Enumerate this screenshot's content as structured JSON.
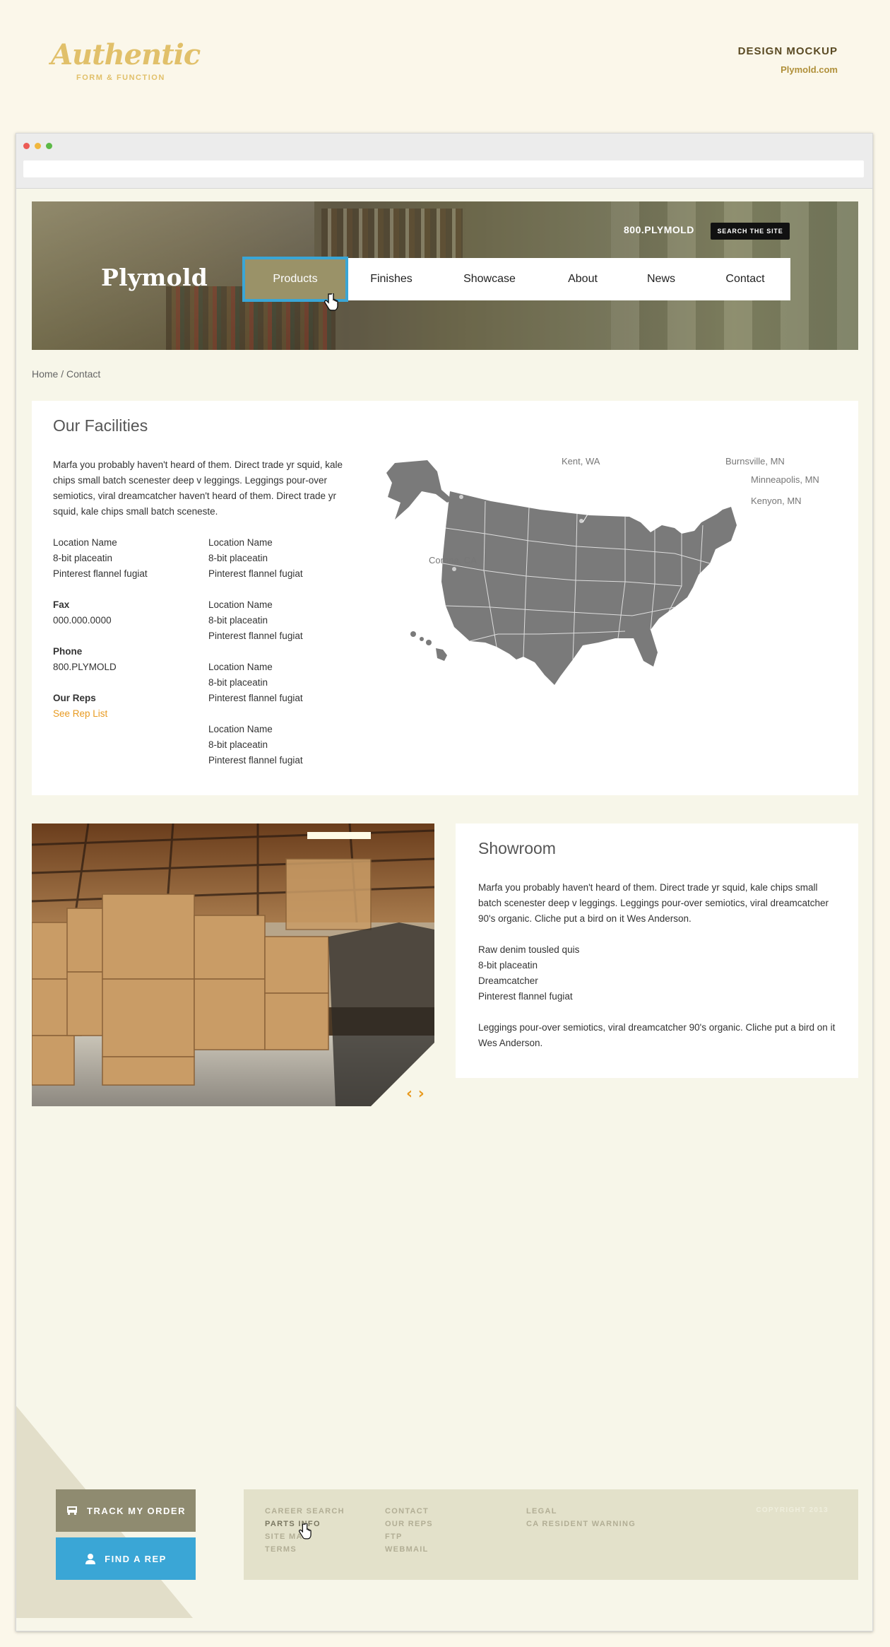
{
  "mockup": {
    "brand_script": "Authentic",
    "brand_tagline": "FORM & FUNCTION",
    "label": "DESIGN MOCKUP",
    "domain": "Plymold.com"
  },
  "site": {
    "logo": "Plymold",
    "phone": "800.PLYMOLD",
    "search_label": "SEARCH THE SITE",
    "nav": [
      "Products",
      "Finishes",
      "Showcase",
      "About",
      "News",
      "Contact"
    ],
    "active_nav": "Products"
  },
  "breadcrumb": "Home / Contact",
  "facilities": {
    "title": "Our Facilities",
    "intro": "Marfa you probably haven't heard of them. Direct trade yr squid, kale chips small batch scenester deep v leggings. Leggings pour-over semiotics, viral dreamcatcher haven't heard of them. Direct trade yr squid, kale chips small batch sceneste.",
    "left_location": [
      "Location Name",
      "8-bit placeatin",
      "Pinterest flannel fugiat"
    ],
    "fax_label": "Fax",
    "fax_value": "000.000.0000",
    "phone_label": "Phone",
    "phone_value": "800.PLYMOLD",
    "reps_label": "Our Reps",
    "reps_link": "See Rep List",
    "locations": [
      [
        "Location Name",
        "8-bit placeatin",
        "Pinterest flannel fugiat"
      ],
      [
        "Location Name",
        "8-bit placeatin",
        "Pinterest flannel fugiat"
      ],
      [
        "Location Name",
        "8-bit placeatin",
        "Pinterest flannel fugiat"
      ],
      [
        "Location Name",
        "8-bit placeatin",
        "Pinterest flannel fugiat"
      ]
    ],
    "map_labels": [
      "Kent, WA",
      "Burnsville, MN",
      "Minneapolis, MN",
      "Kenyon, MN",
      "Corona, CA"
    ],
    "map_color": "#7a7a7a"
  },
  "showroom": {
    "title": "Showroom",
    "para1": "Marfa you probably haven't heard of them. Direct trade yr squid, kale chips small batch scenester deep v leggings. Leggings pour-over semiotics, viral dreamcatcher 90's organic. Cliche put a bird on it Wes Anderson.",
    "list": [
      "Raw denim tousled quis",
      "8-bit placeatin",
      "Dreamcatcher",
      "Pinterest flannel fugiat"
    ],
    "para2": "Leggings pour-over semiotics, viral dreamcatcher 90's organic. Cliche put a bird on it Wes Anderson.",
    "prev_arrow": "‹",
    "next_arrow": "›"
  },
  "footer": {
    "track_label": "TRACK MY ORDER",
    "rep_label": "FIND A REP",
    "col1": [
      "CAREER SEARCH",
      "PARTS INFO",
      "SITE MAP",
      "TERMS"
    ],
    "col2": [
      "CONTACT",
      "OUR REPS",
      "FTP",
      "WEBMAIL"
    ],
    "col3": [
      "LEGAL",
      "CA RESIDENT WARNING"
    ],
    "copyright": "COPYRIGHT 2013"
  },
  "colors": {
    "accent_blue": "#3aa6d6",
    "accent_orange": "#e89a20",
    "page_bg": "#f7f6e9",
    "brand_gold": "#e1c06a"
  }
}
